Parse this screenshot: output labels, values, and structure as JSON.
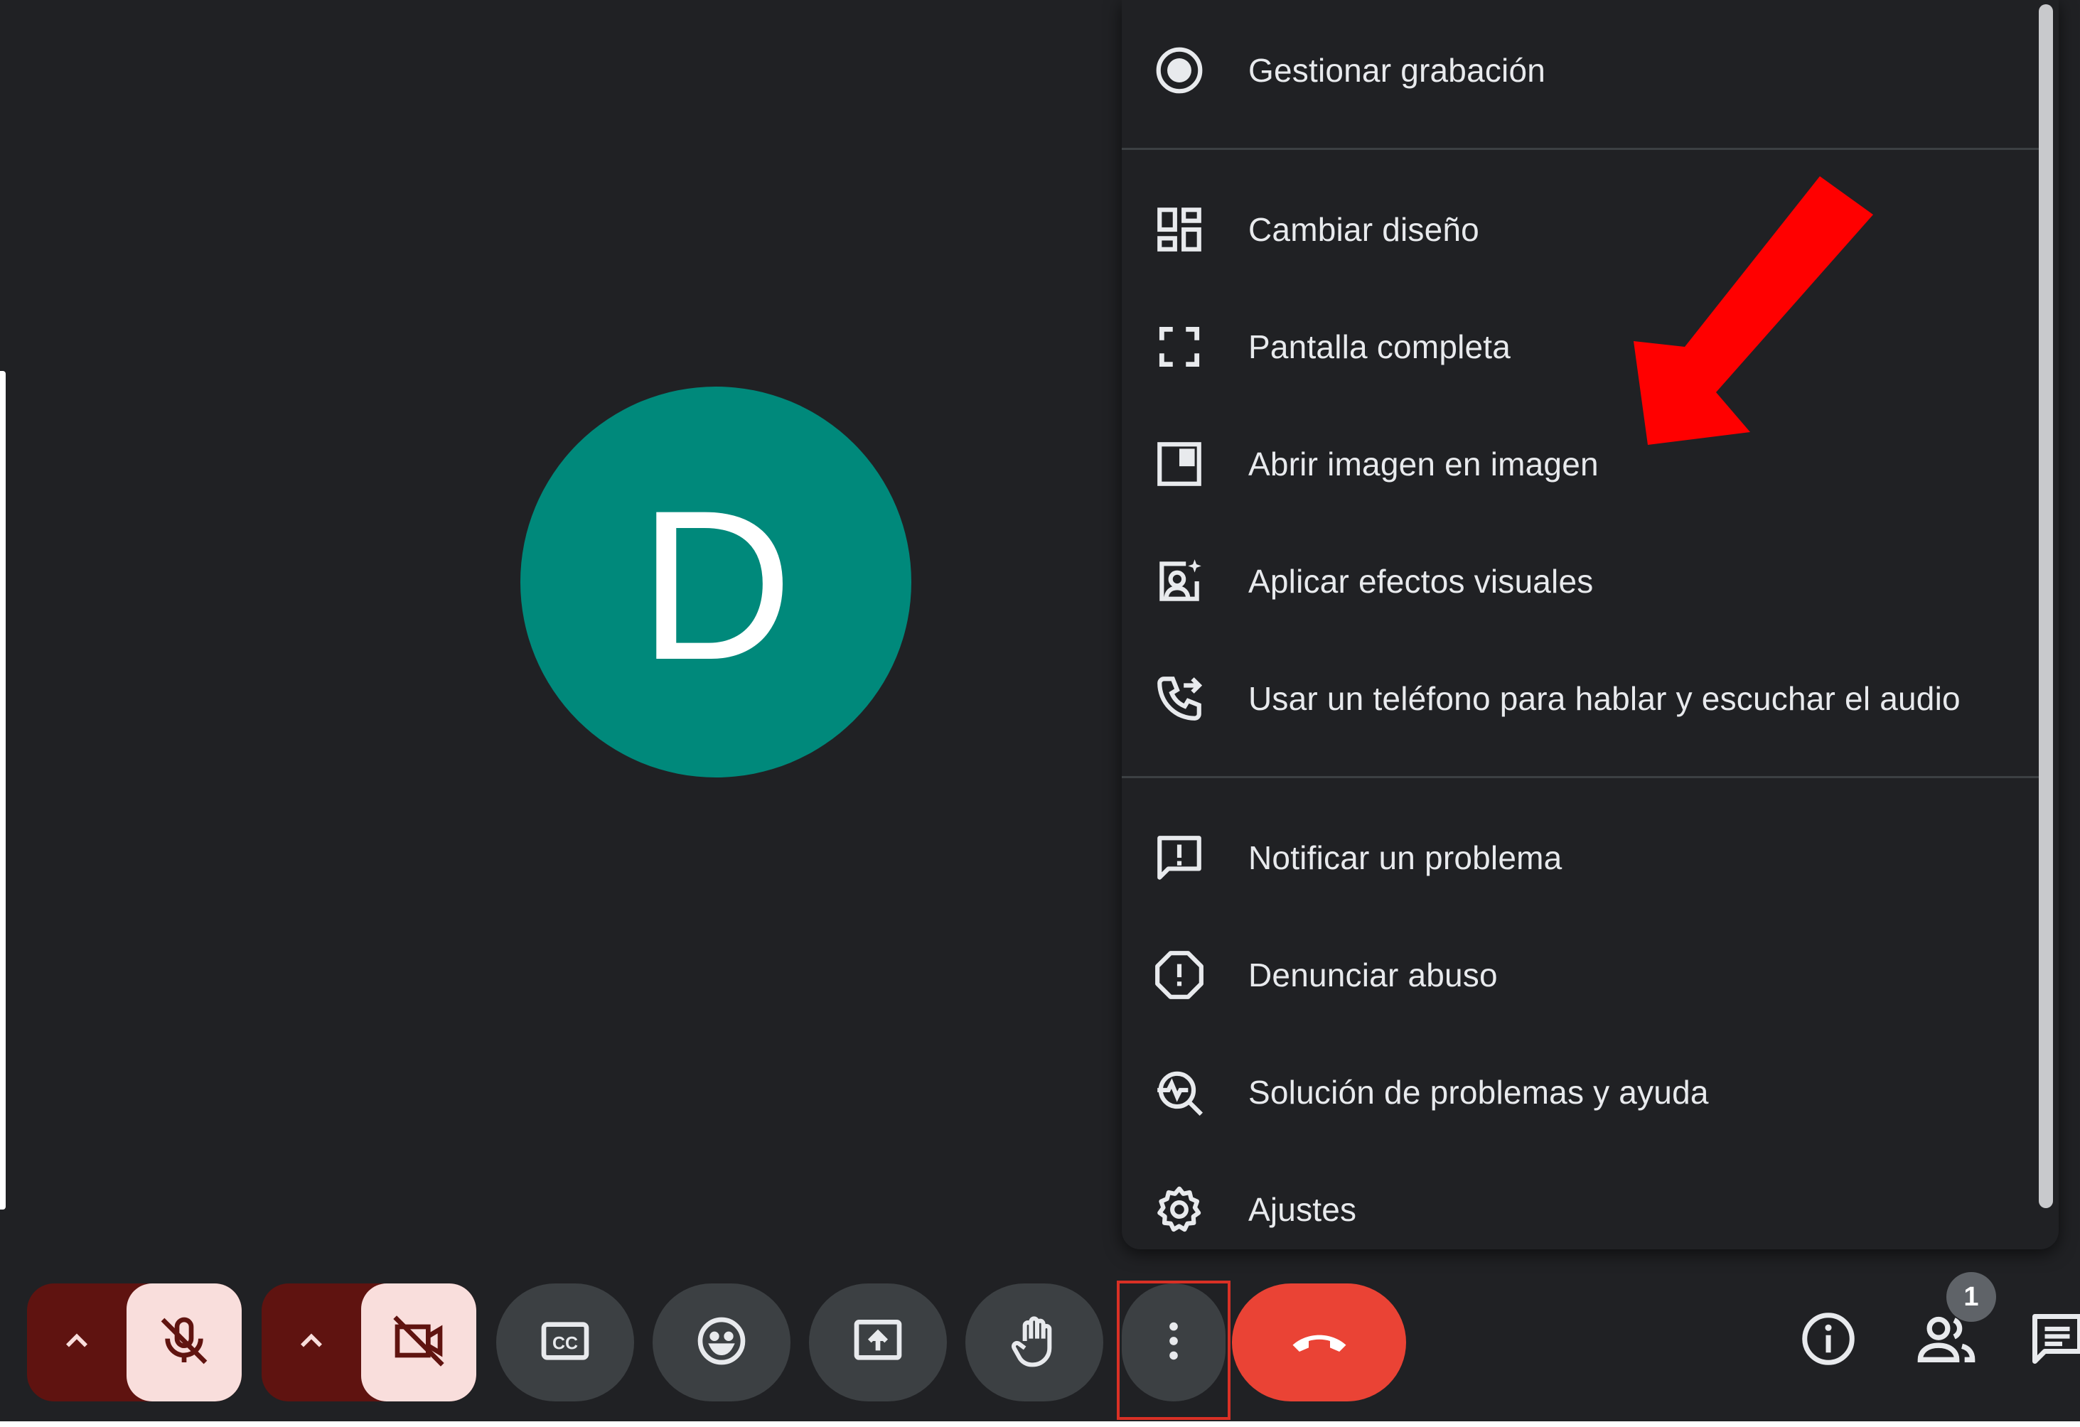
{
  "theme": {
    "background": "#202124",
    "avatar_color": "#00897b",
    "end_call_color": "#ea4335",
    "muted_button_color": "#f9dedc",
    "muted_split_color": "#5f1310",
    "annotation_color": "#ff0000"
  },
  "participant": {
    "avatar_initial": "D"
  },
  "menu": {
    "items": [
      {
        "label": "Gestionar grabación",
        "icon": "record-icon"
      },
      {
        "label": "Cambiar diseño",
        "icon": "layout-icon"
      },
      {
        "label": "Pantalla completa",
        "icon": "fullscreen-icon"
      },
      {
        "label": "Abrir imagen en imagen",
        "icon": "picture-in-picture-icon"
      },
      {
        "label": "Aplicar efectos visuales",
        "icon": "visual-effects-icon"
      },
      {
        "label": "Usar un teléfono para hablar y escuchar el audio",
        "icon": "phone-forward-icon"
      },
      {
        "label": "Notificar un problema",
        "icon": "feedback-icon"
      },
      {
        "label": "Denunciar abuso",
        "icon": "report-icon"
      },
      {
        "label": "Solución de problemas y ayuda",
        "icon": "troubleshoot-icon"
      },
      {
        "label": "Ajustes",
        "icon": "settings-icon"
      }
    ]
  },
  "toolbar": {
    "buttons": [
      {
        "name": "microphone-options",
        "icon": "chevron-up-icon"
      },
      {
        "name": "microphone",
        "icon": "mic-off-icon",
        "state": "muted"
      },
      {
        "name": "camera-options",
        "icon": "chevron-up-icon"
      },
      {
        "name": "camera",
        "icon": "videocam-off-icon",
        "state": "off"
      },
      {
        "name": "captions",
        "icon": "closed-captions-icon"
      },
      {
        "name": "reactions",
        "icon": "emoji-icon"
      },
      {
        "name": "present",
        "icon": "present-screen-icon"
      },
      {
        "name": "raise-hand",
        "icon": "hand-icon"
      },
      {
        "name": "more-options",
        "icon": "more-vert-icon"
      },
      {
        "name": "end-call",
        "icon": "call-end-icon"
      }
    ],
    "right": {
      "info_icon": "info-icon",
      "people_icon": "people-icon",
      "people_count": "1",
      "chat_icon": "chat-icon"
    }
  }
}
